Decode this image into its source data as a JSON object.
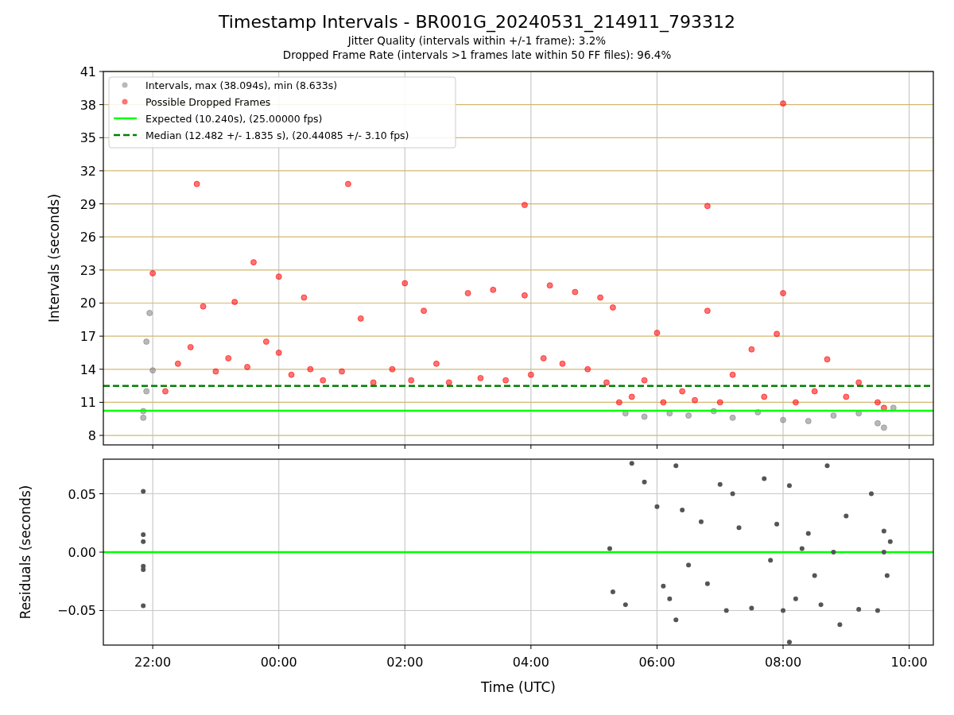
{
  "figure": {
    "title": "Timestamp Intervals - BR001G_20240531_214911_793312",
    "subtitles": [
      "Jitter Quality (intervals within +/-1 frame): 3.2%",
      "Dropped Frame Rate (intervals >1 frames late within 50 FF files): 96.4%"
    ]
  },
  "interval_chart": {
    "chart_data": {
      "type": "scatter",
      "ylabel": "Intervals (seconds)",
      "grid": true,
      "xlim": [
        "2024-05-31T21:13",
        "2024-06-01T10:23"
      ],
      "ylim": [
        7.14,
        41
      ],
      "yticks": [
        {
          "value": 8,
          "label": "8"
        },
        {
          "value": 11,
          "label": "11"
        },
        {
          "value": 14,
          "label": "14"
        },
        {
          "value": 17,
          "label": "17"
        },
        {
          "value": 20,
          "label": "20"
        },
        {
          "value": 23,
          "label": "23"
        },
        {
          "value": 26,
          "label": "26"
        },
        {
          "value": 29,
          "label": "29"
        },
        {
          "value": 32,
          "label": "32"
        },
        {
          "value": 35,
          "label": "35"
        },
        {
          "value": 38,
          "label": "38"
        },
        {
          "value": 41,
          "label": "41"
        }
      ],
      "series": [
        {
          "name": "Intervals, max (38.094s), min (8.633s)",
          "color": "#808080",
          "x": [
            "2024-05-31T21:51",
            "2024-05-31T21:51",
            "2024-05-31T21:54",
            "2024-05-31T21:54",
            "2024-05-31T21:57",
            "2024-05-31T22:00",
            "2024-06-01T05:30",
            "2024-06-01T05:48",
            "2024-06-01T06:12",
            "2024-06-01T06:30",
            "2024-06-01T06:54",
            "2024-06-01T07:12",
            "2024-06-01T07:36",
            "2024-06-01T08:00",
            "2024-06-01T08:24",
            "2024-06-01T08:48",
            "2024-06-01T09:12",
            "2024-06-01T09:30",
            "2024-06-01T09:36",
            "2024-06-01T09:45"
          ],
          "values": [
            9.6,
            10.2,
            12,
            16.5,
            19.1,
            13.9,
            10,
            9.7,
            10,
            9.8,
            10.2,
            9.6,
            10.1,
            9.4,
            9.3,
            9.8,
            10,
            9.1,
            8.7,
            10.5
          ]
        },
        {
          "name": "Possible Dropped Frames",
          "color": "#ff0000",
          "x": [
            "2024-05-31T22:00",
            "2024-05-31T22:12",
            "2024-05-31T22:24",
            "2024-05-31T22:36",
            "2024-05-31T22:42",
            "2024-05-31T22:48",
            "2024-05-31T23:00",
            "2024-05-31T23:12",
            "2024-05-31T23:18",
            "2024-05-31T23:30",
            "2024-05-31T23:36",
            "2024-05-31T23:48",
            "2024-06-01T00:00",
            "2024-06-01T00:00",
            "2024-06-01T00:12",
            "2024-06-01T00:24",
            "2024-06-01T00:30",
            "2024-06-01T00:42",
            "2024-06-01T01:00",
            "2024-06-01T01:06",
            "2024-06-01T01:18",
            "2024-06-01T01:30",
            "2024-06-01T01:48",
            "2024-06-01T02:00",
            "2024-06-01T02:06",
            "2024-06-01T02:18",
            "2024-06-01T02:30",
            "2024-06-01T02:42",
            "2024-06-01T03:00",
            "2024-06-01T03:12",
            "2024-06-01T03:24",
            "2024-06-01T03:36",
            "2024-06-01T03:54",
            "2024-06-01T03:54",
            "2024-06-01T04:00",
            "2024-06-01T04:12",
            "2024-06-01T04:18",
            "2024-06-01T04:30",
            "2024-06-01T04:42",
            "2024-06-01T04:54",
            "2024-06-01T05:06",
            "2024-06-01T05:12",
            "2024-06-01T05:18",
            "2024-06-01T05:24",
            "2024-06-01T05:36",
            "2024-06-01T05:48",
            "2024-06-01T06:00",
            "2024-06-01T06:06",
            "2024-06-01T06:24",
            "2024-06-01T06:36",
            "2024-06-01T06:48",
            "2024-06-01T06:48",
            "2024-06-01T07:00",
            "2024-06-01T07:12",
            "2024-06-01T07:30",
            "2024-06-01T07:42",
            "2024-06-01T07:54",
            "2024-06-01T08:00",
            "2024-06-01T08:00",
            "2024-06-01T08:12",
            "2024-06-01T08:30",
            "2024-06-01T08:42",
            "2024-06-01T09:00",
            "2024-06-01T09:12",
            "2024-06-01T09:30",
            "2024-06-01T09:36"
          ],
          "values": [
            22.7,
            12,
            14.5,
            16,
            30.8,
            19.7,
            13.8,
            15,
            20.1,
            14.2,
            23.7,
            16.5,
            22.4,
            15.5,
            13.5,
            20.5,
            14,
            13,
            13.8,
            30.8,
            18.6,
            12.8,
            14,
            21.8,
            13,
            19.3,
            14.5,
            12.8,
            20.9,
            13.2,
            21.2,
            13,
            28.9,
            20.7,
            13.5,
            15,
            21.6,
            14.5,
            21,
            14,
            20.5,
            12.8,
            19.6,
            11,
            11.5,
            13,
            17.3,
            11,
            12,
            11.2,
            28.8,
            19.3,
            11,
            13.5,
            15.8,
            11.5,
            17.2,
            38.1,
            20.9,
            11,
            12,
            14.9,
            11.5,
            12.8,
            11,
            10.5
          ]
        }
      ],
      "ref_lines": [
        {
          "axis": "y",
          "value": 10.24,
          "label": "Expected (10.240s), (25.00000 fps)",
          "color": "#00ff00"
        },
        {
          "axis": "y",
          "value": 12.482,
          "label": "Median (12.482 +/- 1.835 s), (20.44085 +/- 3.10 fps)",
          "color": "#008000"
        }
      ],
      "legend": true
    }
  },
  "residual_chart": {
    "chart_data": {
      "type": "scatter",
      "xlabel": "Time (UTC)",
      "ylabel": "Residuals (seconds)",
      "grid": true,
      "xlim": [
        "2024-05-31T21:13",
        "2024-06-01T10:23"
      ],
      "ylim": [
        -0.0796,
        0.0796
      ],
      "xticks": [
        {
          "value": "2024-05-31T22:00",
          "label": "22:00"
        },
        {
          "value": "2024-06-01T00:00",
          "label": "00:00"
        },
        {
          "value": "2024-06-01T02:00",
          "label": "02:00"
        },
        {
          "value": "2024-06-01T04:00",
          "label": "04:00"
        },
        {
          "value": "2024-06-01T06:00",
          "label": "06:00"
        },
        {
          "value": "2024-06-01T08:00",
          "label": "08:00"
        },
        {
          "value": "2024-06-01T10:00",
          "label": "10:00"
        }
      ],
      "yticks": [
        {
          "value": -0.05,
          "label": "−0.05"
        },
        {
          "value": 0,
          "label": "0.00"
        },
        {
          "value": 0.05,
          "label": "0.05"
        }
      ],
      "series": [
        {
          "color": "#555555",
          "x": [
            "2024-05-31T21:51",
            "2024-05-31T21:51",
            "2024-05-31T21:51",
            "2024-05-31T21:51",
            "2024-05-31T21:51",
            "2024-05-31T21:51",
            "2024-06-01T05:15",
            "2024-06-01T05:18",
            "2024-06-01T05:30",
            "2024-06-01T05:36",
            "2024-06-01T05:48",
            "2024-06-01T06:00",
            "2024-06-01T06:06",
            "2024-06-01T06:12",
            "2024-06-01T06:18",
            "2024-06-01T06:18",
            "2024-06-01T06:24",
            "2024-06-01T06:30",
            "2024-06-01T06:42",
            "2024-06-01T06:48",
            "2024-06-01T07:00",
            "2024-06-01T07:06",
            "2024-06-01T07:12",
            "2024-06-01T07:18",
            "2024-06-01T07:30",
            "2024-06-01T07:42",
            "2024-06-01T07:48",
            "2024-06-01T07:54",
            "2024-06-01T08:00",
            "2024-06-01T08:06",
            "2024-06-01T08:12",
            "2024-06-01T08:18",
            "2024-06-01T08:24",
            "2024-06-01T08:30",
            "2024-06-01T08:36",
            "2024-06-01T08:42",
            "2024-06-01T08:48",
            "2024-06-01T08:54",
            "2024-06-01T09:00",
            "2024-06-01T09:12",
            "2024-06-01T09:24",
            "2024-06-01T09:30",
            "2024-06-01T09:36",
            "2024-06-01T09:36",
            "2024-06-01T09:39",
            "2024-06-01T09:42",
            "2024-06-01T08:06"
          ],
          "values": [
            0.052,
            0.015,
            0.009,
            -0.012,
            -0.015,
            -0.046,
            0.003,
            -0.034,
            -0.045,
            0.076,
            0.06,
            0.039,
            -0.029,
            -0.04,
            0.074,
            -0.058,
            0.036,
            -0.011,
            0.026,
            -0.027,
            0.058,
            -0.05,
            0.05,
            0.021,
            -0.048,
            0.063,
            -0.007,
            0.024,
            -0.05,
            0.057,
            -0.04,
            0.003,
            0.016,
            -0.02,
            -0.045,
            0.074,
            0.0,
            -0.062,
            0.031,
            -0.049,
            0.05,
            -0.05,
            0.0,
            0.018,
            -0.02,
            0.009,
            -0.077
          ]
        }
      ],
      "ref_lines": [
        {
          "axis": "y",
          "value": 0,
          "color": "#00ff00"
        }
      ]
    }
  }
}
